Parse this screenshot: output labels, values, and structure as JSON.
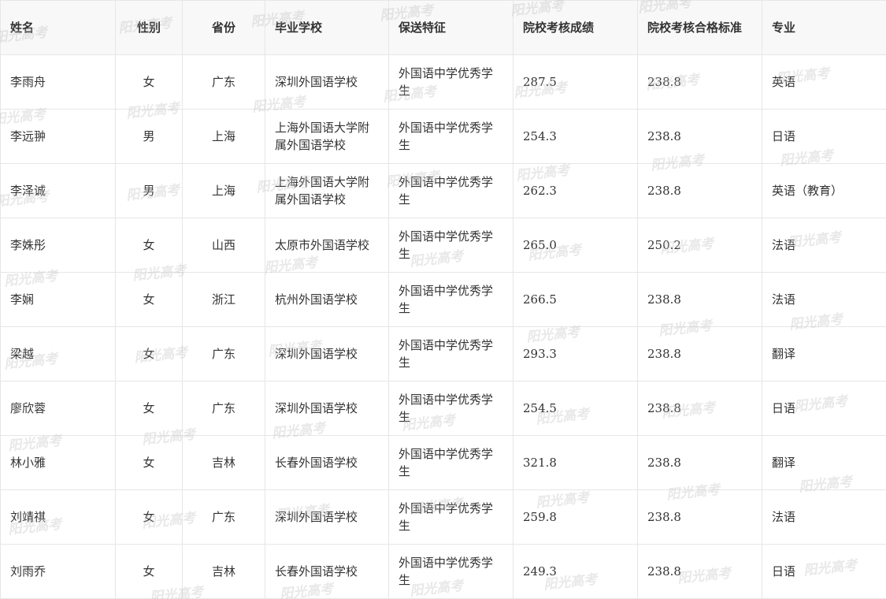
{
  "table": {
    "headers": [
      "姓名",
      "性别",
      "省份",
      "毕业学校",
      "保送特征",
      "院校考核成绩",
      "院校考核合格标准",
      "专业"
    ],
    "rows": [
      [
        "李雨舟",
        "女",
        "广东",
        "深圳外国语学校",
        "外国语中学优秀学生",
        "287.5",
        "238.8",
        "英语"
      ],
      [
        "李远翀",
        "男",
        "上海",
        "上海外国语大学附属外国语学校",
        "外国语中学优秀学生",
        "254.3",
        "238.8",
        "日语"
      ],
      [
        "李泽诚",
        "男",
        "上海",
        "上海外国语大学附属外国语学校",
        "外国语中学优秀学生",
        "262.3",
        "238.8",
        "英语（教育）"
      ],
      [
        "李姝彤",
        "女",
        "山西",
        "太原市外国语学校",
        "外国语中学优秀学生",
        "265.0",
        "250.2",
        "法语"
      ],
      [
        "李娴",
        "女",
        "浙江",
        "杭州外国语学校",
        "外国语中学优秀学生",
        "266.5",
        "238.8",
        "法语"
      ],
      [
        "梁越",
        "女",
        "广东",
        "深圳外国语学校",
        "外国语中学优秀学生",
        "293.3",
        "238.8",
        "翻译"
      ],
      [
        "廖欣蓉",
        "女",
        "广东",
        "深圳外国语学校",
        "外国语中学优秀学生",
        "254.5",
        "238.8",
        "日语"
      ],
      [
        "林小雅",
        "女",
        "吉林",
        "长春外国语学校",
        "外国语中学优秀学生",
        "321.8",
        "238.8",
        "翻译"
      ],
      [
        "刘靖祺",
        "女",
        "广东",
        "深圳外国语学校",
        "外国语中学优秀学生",
        "259.8",
        "238.8",
        "法语"
      ],
      [
        "刘雨乔",
        "女",
        "吉林",
        "长春外国语学校",
        "外国语中学优秀学生",
        "249.3",
        "238.8",
        "日语"
      ]
    ]
  },
  "watermark": {
    "text": "阳光高考"
  }
}
